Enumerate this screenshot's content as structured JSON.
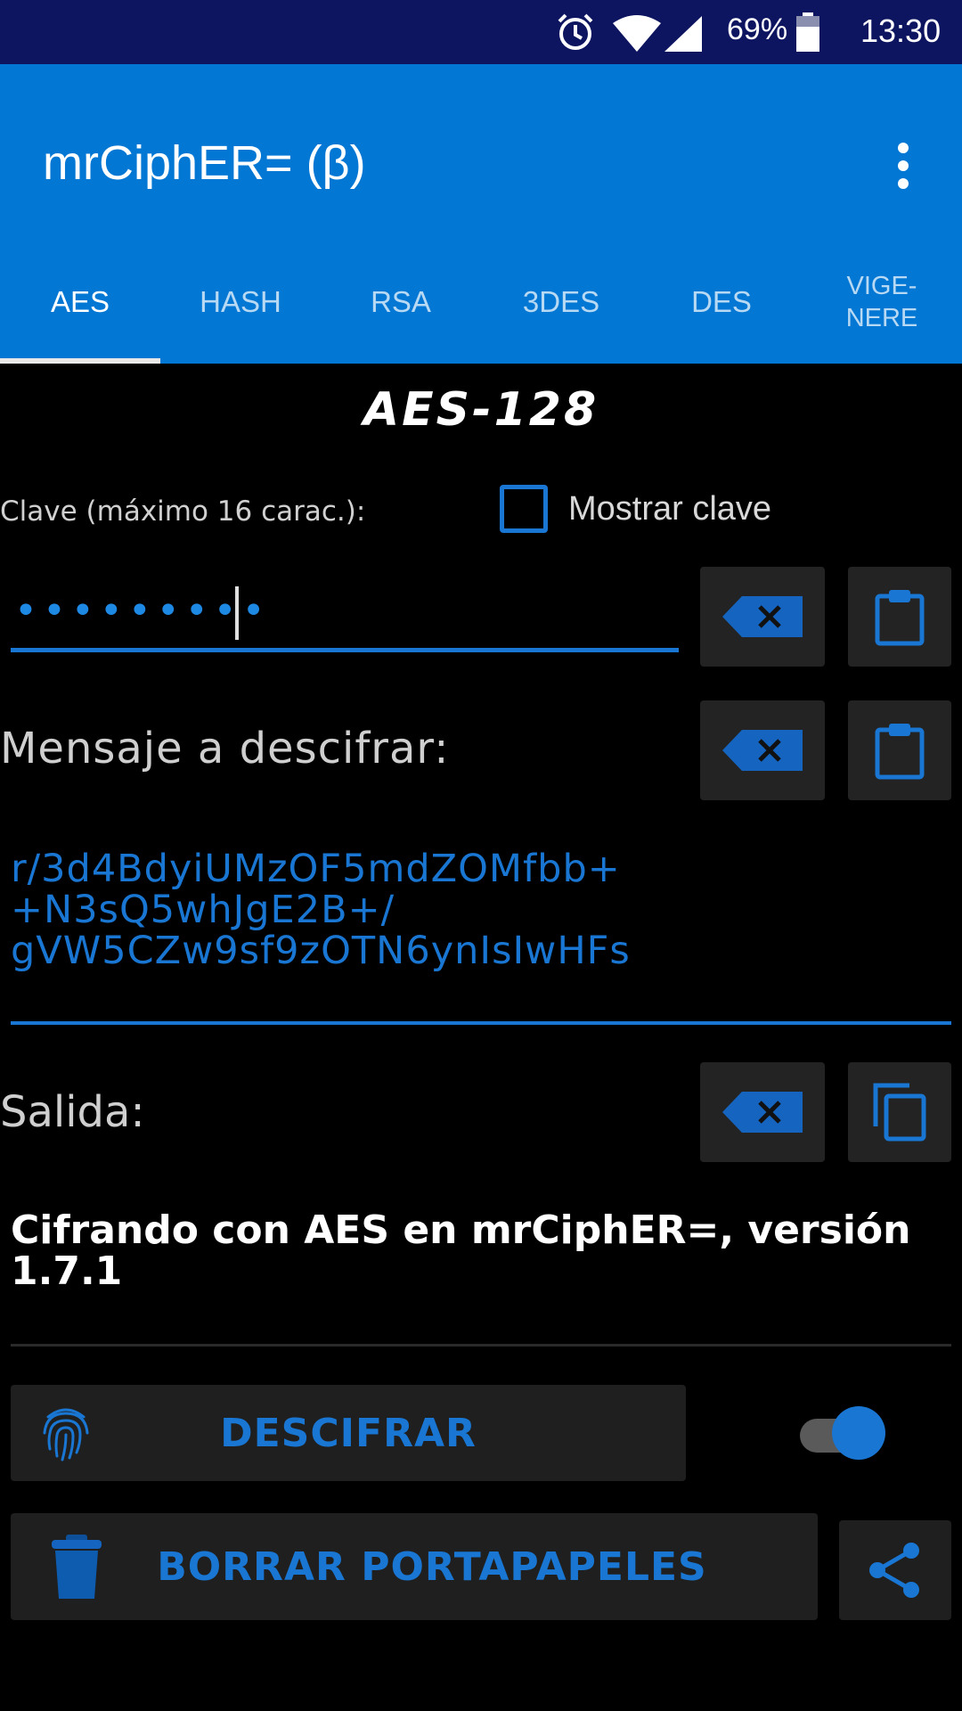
{
  "status_bar": {
    "battery_percent": "69%",
    "time": "13:30",
    "icons": [
      "alarm-icon",
      "wifi-icon",
      "cell-signal-icon",
      "battery-icon"
    ]
  },
  "app_bar": {
    "title": "mrCiphER= (β)",
    "tabs": [
      {
        "label": "AES",
        "active": true
      },
      {
        "label": "HASH",
        "active": false
      },
      {
        "label": "RSA",
        "active": false
      },
      {
        "label": "3DES",
        "active": false
      },
      {
        "label": "DES",
        "active": false
      },
      {
        "label_line1": "VIGE-",
        "label_line2": "NERE",
        "active": false
      }
    ]
  },
  "main": {
    "section_title": "AES-128",
    "key_label": "Clave (máximo 16 carac.):",
    "show_key": {
      "label": "Mostrar clave",
      "checked": false
    },
    "key_masked": "•••••••••",
    "message_label": "Mensaje a descifrar:",
    "cipher_lines": [
      "r/3d4BdyiUMzOF5mdZOMfbb+",
      "+N3sQ5whJgE2B+/",
      "gVW5CZw9sf9zOTN6ynIsIwHFs"
    ],
    "output_label": "Salida:",
    "output_lines": [
      "Cifrando con AES en mrCiphER=, versión",
      "1.7.1"
    ],
    "decipher_label": "DESCIFRAR",
    "toggle_on": true,
    "clear_clipboard_label": "BORRAR PORTAPAPELES"
  },
  "colors": {
    "status_bar": "#0d1560",
    "app_bar": "#0277d4",
    "accent": "#1976d2",
    "background": "#000000",
    "button_bg": "#232323"
  }
}
